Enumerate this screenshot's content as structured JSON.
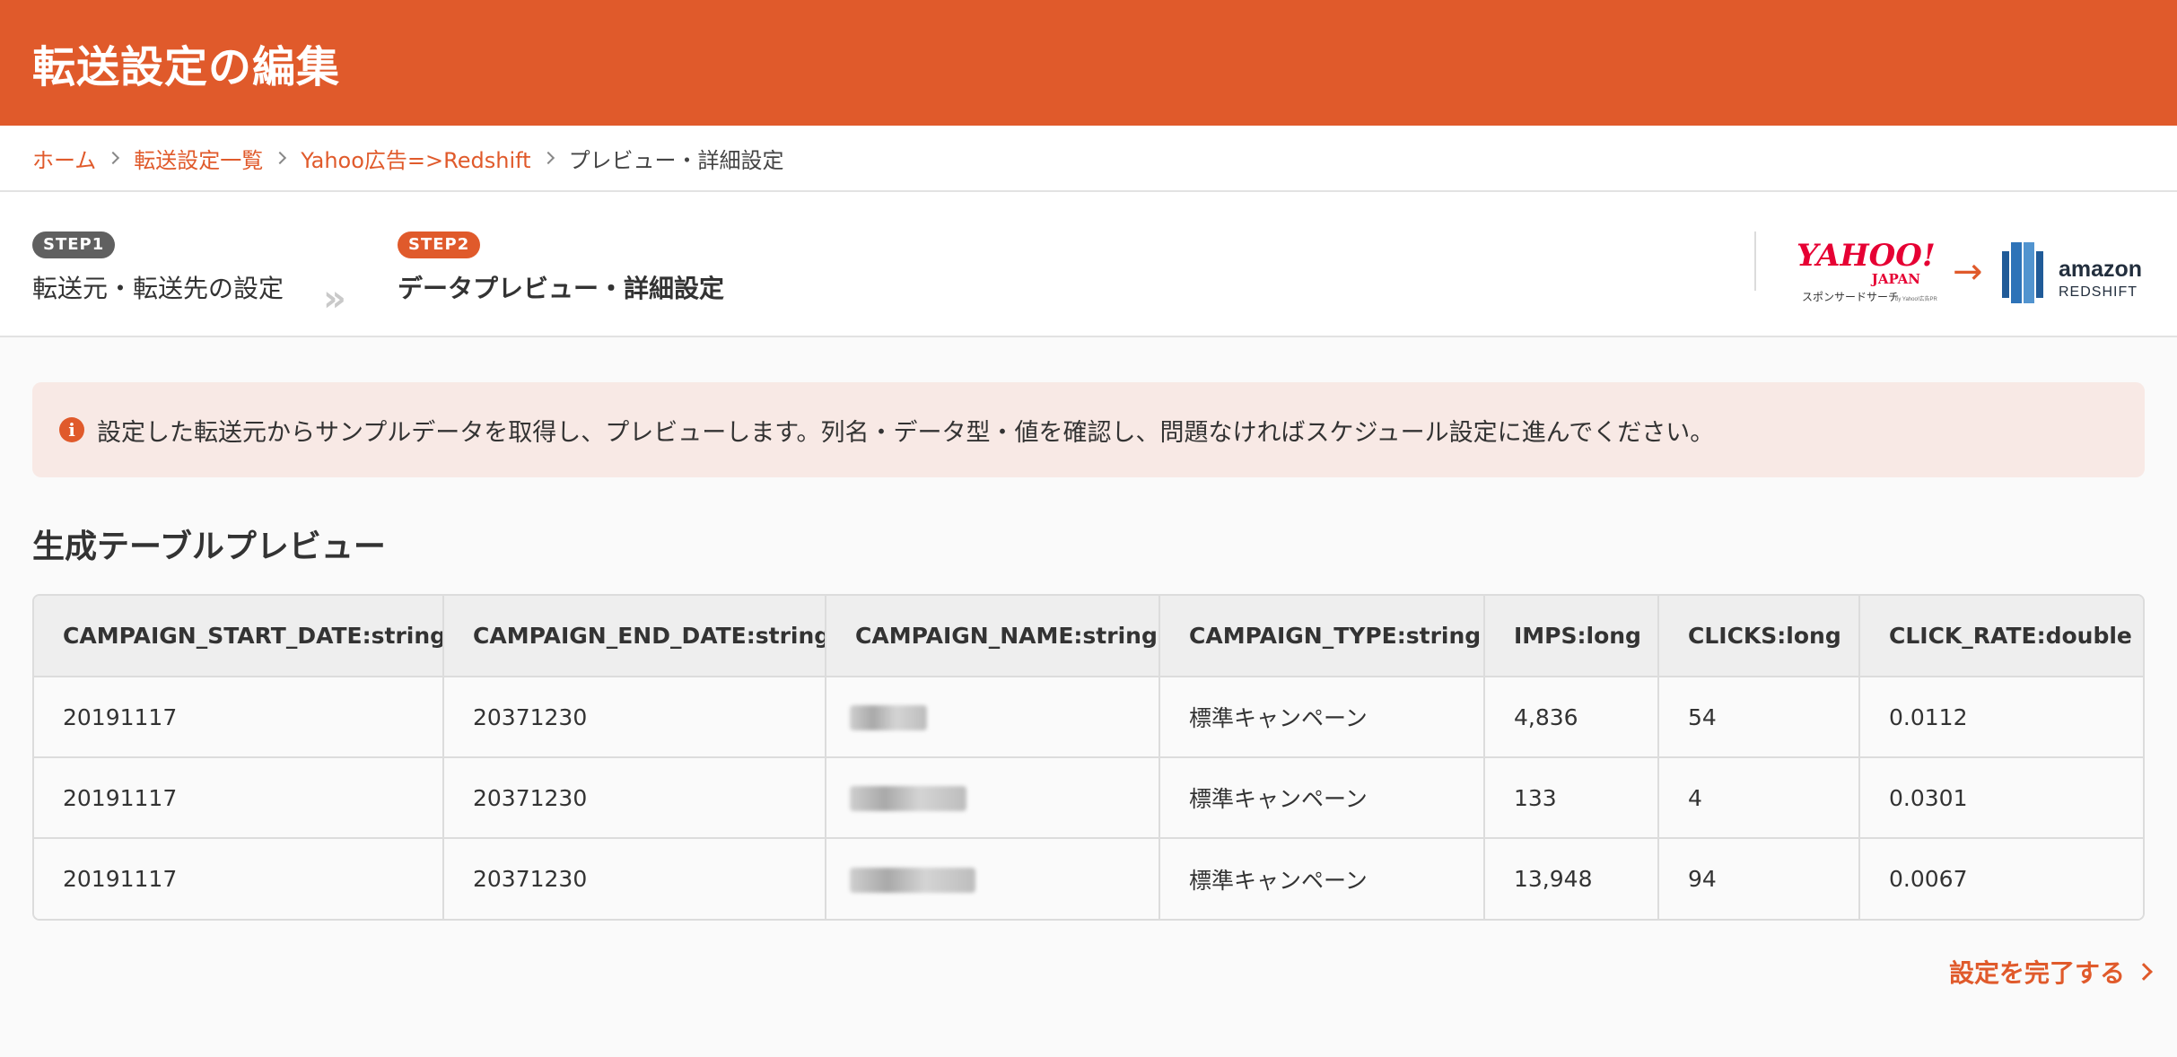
{
  "header": {
    "title": "転送設定の編集"
  },
  "breadcrumb": [
    {
      "label": "ホーム"
    },
    {
      "label": "転送設定一覧"
    },
    {
      "label": "Yahoo広告=>Redshift"
    },
    {
      "label": "プレビュー・詳細設定"
    }
  ],
  "steps": [
    {
      "badge": "STEP1",
      "label": "転送元・転送先の設定"
    },
    {
      "badge": "STEP2",
      "label": "データプレビュー・詳細設定"
    }
  ],
  "step_separator": "»",
  "logos": {
    "source": {
      "name": "YAHOO!",
      "sub": "JAPAN",
      "caption": "スポンサードサーチ",
      "caption_small": "by Yahoo!広告PR"
    },
    "arrow": "→",
    "destination": {
      "name": "amazon",
      "sub": "REDSHIFT"
    }
  },
  "colors": {
    "accent": "#e05a2b",
    "info_bg": "#f8e9e5",
    "table_header_bg": "#eeeeee"
  },
  "info": {
    "icon": "info-icon",
    "text": "設定した転送元からサンプルデータを取得し、プレビューします。列名・データ型・値を確認し、問題なければスケジュール設定に進んでください。"
  },
  "preview": {
    "title": "生成テーブルプレビュー",
    "columns": [
      "CAMPAIGN_START_DATE:string",
      "CAMPAIGN_END_DATE:string",
      "CAMPAIGN_NAME:string",
      "CAMPAIGN_TYPE:string",
      "IMPS:long",
      "CLICKS:long",
      "CLICK_RATE:double"
    ],
    "rows": [
      [
        "20191117",
        "20371230",
        "",
        "標準キャンペーン",
        "4,836",
        "54",
        "0.0112"
      ],
      [
        "20191117",
        "20371230",
        "",
        "標準キャンペーン",
        "133",
        "4",
        "0.0301"
      ],
      [
        "20191117",
        "20371230",
        "",
        "標準キャンペーン",
        "13,948",
        "94",
        "0.0067"
      ]
    ]
  },
  "footer": {
    "complete_label": "設定を完了する"
  }
}
